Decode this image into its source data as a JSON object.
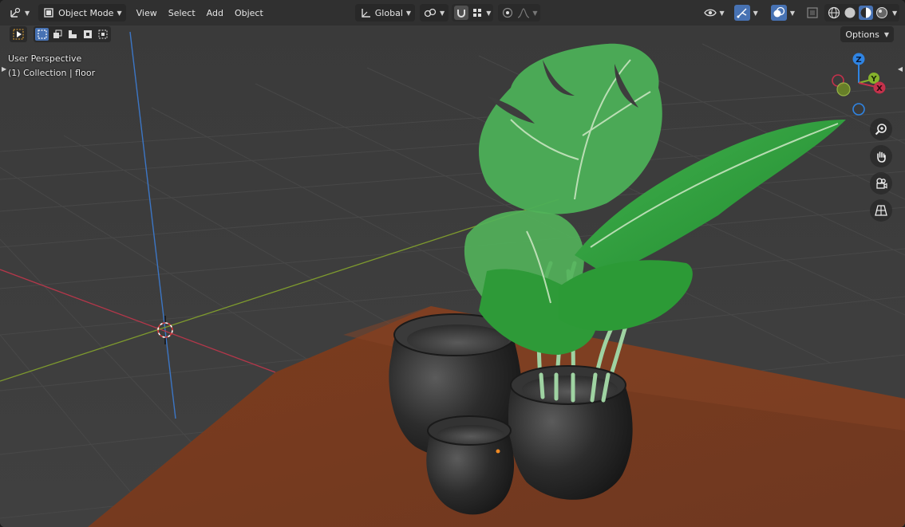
{
  "header": {
    "mode_label": "Object Mode",
    "menus": [
      "View",
      "Select",
      "Add",
      "Object"
    ],
    "transform_orientation": "Global",
    "options_label": "Options"
  },
  "overlay": {
    "view_name": "User Perspective",
    "collection_info": "(1) Collection | floor"
  },
  "gizmo": {
    "z_label": "Z",
    "y_label": "Y",
    "x_label": "X"
  },
  "colors": {
    "accent": "#4772b3",
    "x_axis": "#c4314b",
    "y_axis": "#86b32c",
    "z_axis": "#2f84e3",
    "floor": "#7a3f22",
    "leaf": "#2f9c3c"
  },
  "icons": {
    "editor_type": "editor-type-icon",
    "mode": "object-mode-icon",
    "orientation": "transform-orientation-icon",
    "pivot": "pivot-point-icon",
    "snap": "snap-magnet-icon",
    "snap_target": "snap-target-icon",
    "proportional": "proportional-edit-icon",
    "visibility": "visibility-eye-icon",
    "gizmo_toggle": "gizmo-toggle-icon",
    "overlay_toggle": "overlay-toggle-icon",
    "xray": "xray-icon",
    "zoom": "zoom-icon",
    "pan": "hand-pan-icon",
    "camera": "camera-icon",
    "ortho": "perspective-grid-icon"
  }
}
